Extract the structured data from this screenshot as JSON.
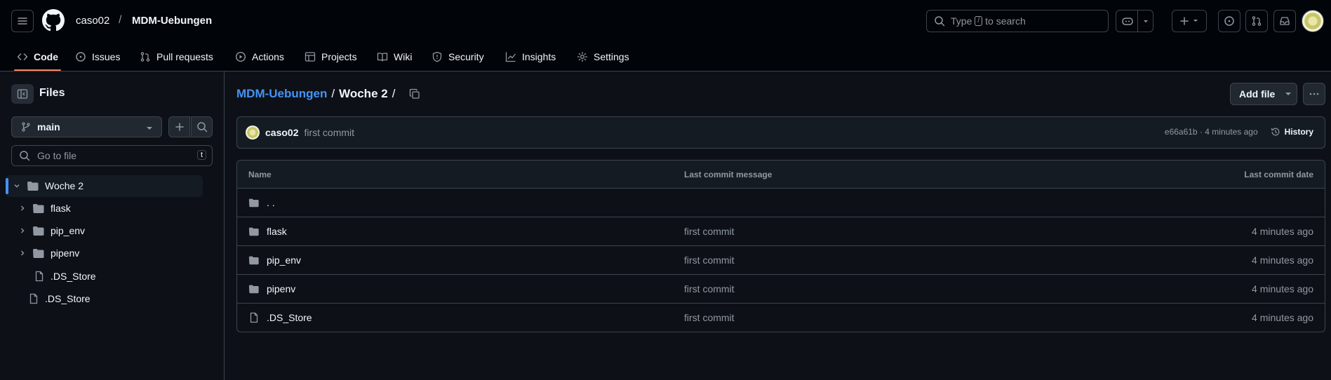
{
  "header": {
    "owner": "caso02",
    "separator": "/",
    "repo": "MDM-Uebungen",
    "search": {
      "prefix": "Type",
      "key": "/",
      "suffix": "to search"
    }
  },
  "nav": {
    "tabs": [
      {
        "label": "Code",
        "icon": "code-icon",
        "active": true
      },
      {
        "label": "Issues",
        "icon": "issue-icon"
      },
      {
        "label": "Pull requests",
        "icon": "pull-request-icon"
      },
      {
        "label": "Actions",
        "icon": "play-icon"
      },
      {
        "label": "Projects",
        "icon": "table-icon"
      },
      {
        "label": "Wiki",
        "icon": "book-icon"
      },
      {
        "label": "Security",
        "icon": "shield-icon"
      },
      {
        "label": "Insights",
        "icon": "graph-icon"
      },
      {
        "label": "Settings",
        "icon": "gear-icon"
      }
    ]
  },
  "sidebar": {
    "title": "Files",
    "branch": "main",
    "goto_placeholder": "Go to file",
    "goto_key": "t",
    "tree": [
      {
        "label": "Woche 2",
        "type": "folder-open"
      },
      {
        "label": "flask",
        "type": "folder"
      },
      {
        "label": "pip_env",
        "type": "folder"
      },
      {
        "label": "pipenv",
        "type": "folder"
      },
      {
        "label": ".DS_Store",
        "type": "file"
      },
      {
        "label": ".DS_Store",
        "type": "file"
      }
    ]
  },
  "main": {
    "breadcrumb": {
      "repo": "MDM-Uebungen",
      "sep": "/",
      "current": "Woche 2",
      "trail": "/"
    },
    "add_file": "Add file",
    "commit": {
      "author": "caso02",
      "message": "first commit",
      "sha_time": "e66a61b · 4 minutes ago",
      "history": "History"
    },
    "table": {
      "headers": {
        "name": "Name",
        "message": "Last commit message",
        "date": "Last commit date"
      },
      "rows": [
        {
          "name": ". .",
          "type": "folder",
          "message": "",
          "date": ""
        },
        {
          "name": "flask",
          "type": "folder",
          "message": "first commit",
          "date": "4 minutes ago"
        },
        {
          "name": "pip_env",
          "type": "folder",
          "message": "first commit",
          "date": "4 minutes ago"
        },
        {
          "name": "pipenv",
          "type": "folder",
          "message": "first commit",
          "date": "4 minutes ago"
        },
        {
          "name": ".DS_Store",
          "type": "file",
          "message": "first commit",
          "date": "4 minutes ago"
        }
      ]
    }
  }
}
